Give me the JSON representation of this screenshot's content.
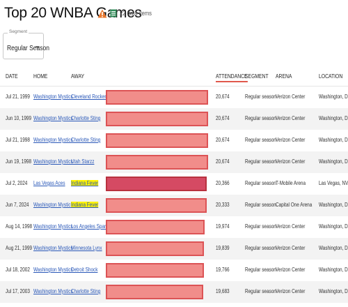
{
  "header": {
    "title": "Top 20 WNBA Games",
    "item_count": "22 data items",
    "warn_icon": "warning-triangle-icon",
    "sheet_icon": "spreadsheet-icon",
    "accent": "#e0584c"
  },
  "segment": {
    "legend": "Segment",
    "value": "Regular Season"
  },
  "table": {
    "columns": {
      "date": "DATE",
      "home": "HOME",
      "away": "AWAY",
      "attendance": "ATTENDANCE",
      "segment": "SEGMENT",
      "arena": "ARENA",
      "location": "LOCATION"
    },
    "bar_max": 20674,
    "rows": [
      {
        "date": "Jul 21, 1999",
        "home": "Washington Mystics",
        "away": "Cleveland Rockers",
        "attendance": "20,674",
        "att_value": 20674,
        "segment": "Regular season",
        "arena": "Verizon Center",
        "location": "Washington, DC",
        "away_highlight": false
      },
      {
        "date": "Jun 10, 1999",
        "home": "Washington Mystics",
        "away": "Charlotte Sting",
        "attendance": "20,674",
        "att_value": 20674,
        "segment": "Regular season",
        "arena": "Verizon Center",
        "location": "Washington, DC",
        "away_highlight": false
      },
      {
        "date": "Jul 21, 1998",
        "home": "Washington Mystics",
        "away": "Charlotte Sting",
        "attendance": "20,674",
        "att_value": 20674,
        "segment": "Regular season",
        "arena": "Verizon Center",
        "location": "Washington, DC",
        "away_highlight": false
      },
      {
        "date": "Jun 19, 1998",
        "home": "Washington Mystics",
        "away": "Utah Starzz",
        "attendance": "20,674",
        "att_value": 20674,
        "segment": "Regular season",
        "arena": "Verizon Center",
        "location": "Washington, DC",
        "away_highlight": false
      },
      {
        "date": "Jul 2, 2024",
        "home": "Las Vegas Aces",
        "away": "Indiana Fever",
        "attendance": "20,366",
        "att_value": 20366,
        "segment": "Regular season",
        "arena": "T-Mobile Arena",
        "location": "Las Vegas, NV",
        "away_highlight": true
      },
      {
        "date": "Jun 7, 2024",
        "home": "Washington Mystics",
        "away": "Indiana Fever",
        "attendance": "20,333",
        "att_value": 20333,
        "segment": "Regular season",
        "arena": "Capital One Arena",
        "location": "Washington, DC",
        "away_highlight": true
      },
      {
        "date": "Aug 14, 1998",
        "home": "Washington Mystics",
        "away": "Los Angeles Sparks",
        "attendance": "19,974",
        "att_value": 19974,
        "segment": "Regular season",
        "arena": "Verizon Center",
        "location": "Washington, DC",
        "away_highlight": false
      },
      {
        "date": "Aug 21, 1999",
        "home": "Washington Mystics",
        "away": "Minnesota Lynx",
        "attendance": "19,839",
        "att_value": 19839,
        "segment": "Regular season",
        "arena": "Verizon Center",
        "location": "Washington, DC",
        "away_highlight": false
      },
      {
        "date": "Jul 18, 2002",
        "home": "Washington Mystics",
        "away": "Detroit Shock",
        "attendance": "19,766",
        "att_value": 19766,
        "segment": "Regular season",
        "arena": "Verizon Center",
        "location": "Washington, DC",
        "away_highlight": false
      },
      {
        "date": "Jul 17, 2003",
        "home": "Washington Mystics",
        "away": "Charlotte Sting",
        "attendance": "19,683",
        "att_value": 19683,
        "segment": "Regular season",
        "arena": "Verizon Center",
        "location": "Washington, DC",
        "away_highlight": false
      }
    ]
  }
}
